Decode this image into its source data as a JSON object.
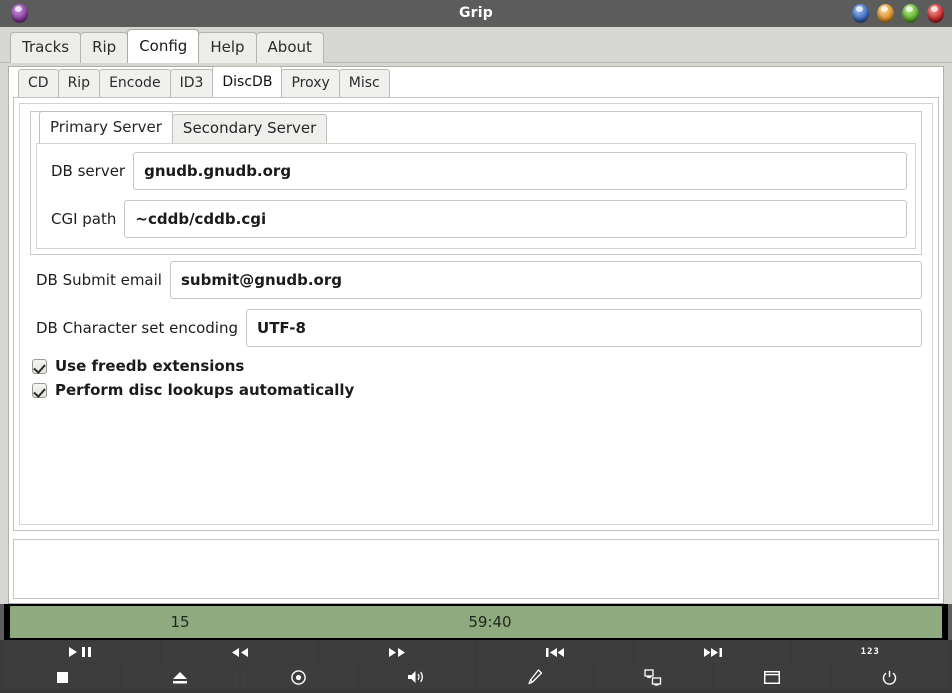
{
  "window": {
    "title": "Grip",
    "icon": "app-orb-icon",
    "buttons": [
      {
        "name": "minimize-button",
        "color": "#3f6fc4"
      },
      {
        "name": "shade-button",
        "color": "#e3992a"
      },
      {
        "name": "maximize-button",
        "color": "#63b62e"
      },
      {
        "name": "close-button",
        "color": "#cf2a2a"
      }
    ]
  },
  "main_tabs": [
    {
      "label": "Tracks",
      "active": false
    },
    {
      "label": "Rip",
      "active": false
    },
    {
      "label": "Config",
      "active": true
    },
    {
      "label": "Help",
      "active": false
    },
    {
      "label": "About",
      "active": false
    }
  ],
  "config_tabs": [
    {
      "label": "CD",
      "active": false
    },
    {
      "label": "Rip",
      "active": false
    },
    {
      "label": "Encode",
      "active": false
    },
    {
      "label": "ID3",
      "active": false
    },
    {
      "label": "DiscDB",
      "active": true
    },
    {
      "label": "Proxy",
      "active": false
    },
    {
      "label": "Misc",
      "active": false
    }
  ],
  "server_tabs": [
    {
      "label": "Primary Server",
      "active": true
    },
    {
      "label": "Secondary Server",
      "active": false
    }
  ],
  "server_fields": [
    {
      "label": "DB server",
      "value": "gnudb.gnudb.org",
      "name": "db-server-input"
    },
    {
      "label": "CGI path",
      "value": "~cddb/cddb.cgi",
      "name": "cgi-path-input"
    }
  ],
  "outer_fields": [
    {
      "label": "DB Submit email",
      "value": "submit@gnudb.org",
      "name": "db-submit-email-input"
    },
    {
      "label": "DB Character set encoding",
      "value": "UTF-8",
      "name": "db-charset-input"
    }
  ],
  "checkboxes": [
    {
      "label": "Use freedb extensions",
      "checked": true,
      "name": "use-freedb-extensions-checkbox"
    },
    {
      "label": "Perform disc lookups automatically",
      "checked": true,
      "name": "auto-disc-lookup-checkbox"
    }
  ],
  "status": {
    "track": "15",
    "time": "59:40",
    "bar_color": "#8faa7f"
  },
  "controls": {
    "row1": [
      {
        "name": "play-pause-button",
        "icon": "play-pause-icon"
      },
      {
        "name": "rewind-button",
        "icon": "rewind-icon"
      },
      {
        "name": "fast-forward-button",
        "icon": "fast-forward-icon"
      },
      {
        "name": "previous-track-button",
        "icon": "previous-track-icon"
      },
      {
        "name": "next-track-button",
        "icon": "next-track-icon"
      },
      {
        "name": "track-numbers-button",
        "icon": "track-numbers-icon",
        "text": "123"
      }
    ],
    "row2": [
      {
        "name": "stop-button",
        "icon": "stop-icon"
      },
      {
        "name": "eject-button",
        "icon": "eject-icon"
      },
      {
        "name": "rip-button",
        "icon": "disc-record-icon"
      },
      {
        "name": "volume-button",
        "icon": "volume-icon"
      },
      {
        "name": "edit-tracks-button",
        "icon": "pencil-icon"
      },
      {
        "name": "discdb-lookup-button",
        "icon": "network-lookup-icon"
      },
      {
        "name": "toggle-window-button",
        "icon": "window-icon"
      },
      {
        "name": "exit-button",
        "icon": "power-icon"
      }
    ]
  }
}
